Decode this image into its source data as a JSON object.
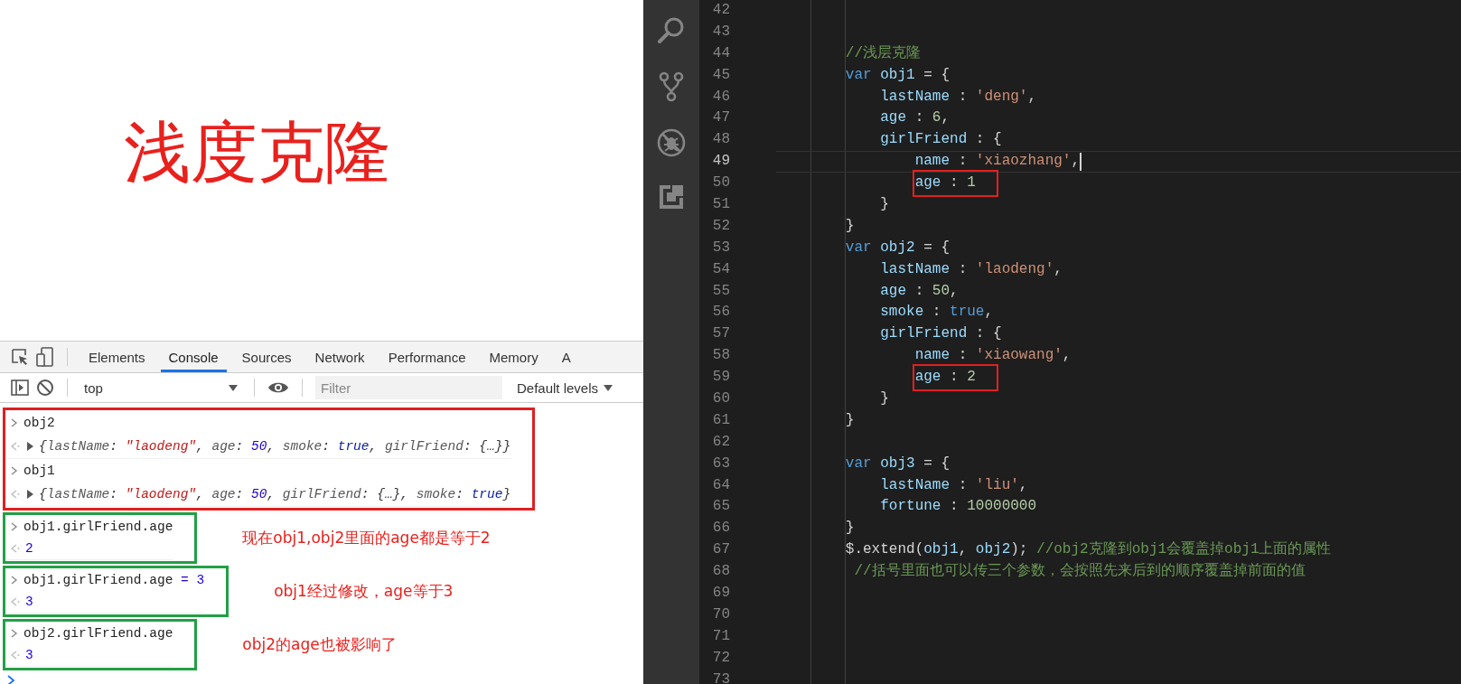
{
  "title": "浅度克隆",
  "devtools": {
    "tabs": [
      {
        "label": "Elements",
        "selected": false
      },
      {
        "label": "Console",
        "selected": true
      },
      {
        "label": "Sources",
        "selected": false
      },
      {
        "label": "Network",
        "selected": false
      },
      {
        "label": "Performance",
        "selected": false
      },
      {
        "label": "Memory",
        "selected": false
      },
      {
        "label": "A",
        "selected": false
      }
    ],
    "context": "top",
    "filter_placeholder": "Filter",
    "levels": "Default levels"
  },
  "console": {
    "groups": [
      {
        "color": "#e02020",
        "entries": [
          {
            "kind": "input",
            "expandable": false,
            "tokens": [
              {
                "text": "obj2",
                "kind": "plain"
              }
            ]
          },
          {
            "kind": "output",
            "expandable": true,
            "tokens": [
              {
                "text": "{",
                "kind": "p"
              },
              {
                "text": "lastName",
                "kind": "key"
              },
              {
                "text": ": ",
                "kind": "p"
              },
              {
                "text": "\"laodeng\"",
                "kind": "str"
              },
              {
                "text": ", ",
                "kind": "p"
              },
              {
                "text": "age",
                "kind": "key"
              },
              {
                "text": ": ",
                "kind": "p"
              },
              {
                "text": "50",
                "kind": "num"
              },
              {
                "text": ", ",
                "kind": "p"
              },
              {
                "text": "smoke",
                "kind": "key"
              },
              {
                "text": ": ",
                "kind": "p"
              },
              {
                "text": "true",
                "kind": "bool"
              },
              {
                "text": ", ",
                "kind": "p"
              },
              {
                "text": "girlFriend",
                "kind": "key"
              },
              {
                "text": ": {…}}",
                "kind": "p"
              }
            ]
          },
          {
            "kind": "input",
            "expandable": false,
            "tokens": [
              {
                "text": "obj1",
                "kind": "plain"
              }
            ]
          },
          {
            "kind": "output",
            "expandable": true,
            "tokens": [
              {
                "text": "{",
                "kind": "p"
              },
              {
                "text": "lastName",
                "kind": "key"
              },
              {
                "text": ": ",
                "kind": "p"
              },
              {
                "text": "\"laodeng\"",
                "kind": "str"
              },
              {
                "text": ", ",
                "kind": "p"
              },
              {
                "text": "age",
                "kind": "key"
              },
              {
                "text": ": ",
                "kind": "p"
              },
              {
                "text": "50",
                "kind": "num"
              },
              {
                "text": ", ",
                "kind": "p"
              },
              {
                "text": "girlFriend",
                "kind": "key"
              },
              {
                "text": ": {…}, ",
                "kind": "p"
              },
              {
                "text": "smoke",
                "kind": "key"
              },
              {
                "text": ": ",
                "kind": "p"
              },
              {
                "text": "true",
                "kind": "bool"
              },
              {
                "text": "}",
                "kind": "p"
              }
            ]
          }
        ]
      },
      {
        "color": "#22a045",
        "note": "现在obj1,obj2里面的age都是等于2",
        "entries": [
          {
            "kind": "input",
            "expandable": false,
            "tokens": [
              {
                "text": "obj1.girlFriend.age",
                "kind": "plain"
              }
            ]
          },
          {
            "kind": "output",
            "expandable": false,
            "tokens": [
              {
                "text": "2",
                "kind": "num"
              }
            ]
          }
        ]
      },
      {
        "color": "#22a045",
        "note": "obj1经过修改，age等于3",
        "entries": [
          {
            "kind": "input",
            "expandable": false,
            "tokens": [
              {
                "text": "obj1.girlFriend.age",
                "kind": "plain"
              },
              {
                "text": " = 3",
                "kind": "num"
              }
            ]
          },
          {
            "kind": "output",
            "expandable": false,
            "tokens": [
              {
                "text": "3",
                "kind": "num"
              }
            ]
          }
        ]
      },
      {
        "color": "#22a045",
        "note": "obj2的age也被影响了",
        "entries": [
          {
            "kind": "input",
            "expandable": false,
            "tokens": [
              {
                "text": "obj2.girlFriend.age",
                "kind": "plain"
              }
            ]
          },
          {
            "kind": "output",
            "expandable": false,
            "tokens": [
              {
                "text": "3",
                "kind": "num"
              }
            ]
          }
        ]
      }
    ]
  },
  "editor": {
    "lines": [
      {
        "number": "42",
        "current": false,
        "boxed": false
      },
      {
        "number": "43",
        "current": false,
        "boxed": false
      },
      {
        "number": "44",
        "current": false,
        "boxed": false,
        "tokens": [
          {
            "text": "        //浅层克隆",
            "kind": "cmt"
          }
        ]
      },
      {
        "number": "45",
        "current": false,
        "boxed": false,
        "tokens": [
          {
            "text": "        var ",
            "kind": "kw"
          },
          {
            "text": "obj1",
            "kind": "var"
          },
          {
            "text": " = {",
            "kind": "txt"
          }
        ]
      },
      {
        "number": "46",
        "current": false,
        "boxed": false,
        "tokens": [
          {
            "text": "            lastName",
            "kind": "var"
          },
          {
            "text": " : ",
            "kind": "txt"
          },
          {
            "text": "'deng'",
            "kind": "str"
          },
          {
            "text": ",",
            "kind": "txt"
          }
        ]
      },
      {
        "number": "47",
        "current": false,
        "boxed": false,
        "tokens": [
          {
            "text": "            age",
            "kind": "var"
          },
          {
            "text": " : ",
            "kind": "txt"
          },
          {
            "text": "6",
            "kind": "num"
          },
          {
            "text": ",",
            "kind": "txt"
          }
        ]
      },
      {
        "number": "48",
        "current": false,
        "boxed": false,
        "tokens": [
          {
            "text": "            girlFriend",
            "kind": "var"
          },
          {
            "text": " : {",
            "kind": "txt"
          }
        ]
      },
      {
        "number": "49",
        "current": true,
        "boxed": false,
        "tokens": [
          {
            "text": "                name",
            "kind": "var"
          },
          {
            "text": " : ",
            "kind": "txt"
          },
          {
            "text": "'xiaozhang'",
            "kind": "str"
          },
          {
            "text": ",",
            "kind": "txt"
          }
        ]
      },
      {
        "number": "50",
        "current": false,
        "boxed": true,
        "tokens": [
          {
            "text": "                age",
            "kind": "var"
          },
          {
            "text": " : ",
            "kind": "txt"
          },
          {
            "text": "1",
            "kind": "num"
          }
        ]
      },
      {
        "number": "51",
        "current": false,
        "boxed": false,
        "tokens": [
          {
            "text": "            }",
            "kind": "txt"
          }
        ]
      },
      {
        "number": "52",
        "current": false,
        "boxed": false,
        "tokens": [
          {
            "text": "        }",
            "kind": "txt"
          }
        ]
      },
      {
        "number": "53",
        "current": false,
        "boxed": false,
        "tokens": [
          {
            "text": "        var ",
            "kind": "kw"
          },
          {
            "text": "obj2",
            "kind": "var"
          },
          {
            "text": " = {",
            "kind": "txt"
          }
        ]
      },
      {
        "number": "54",
        "current": false,
        "boxed": false,
        "tokens": [
          {
            "text": "            lastName",
            "kind": "var"
          },
          {
            "text": " : ",
            "kind": "txt"
          },
          {
            "text": "'laodeng'",
            "kind": "str"
          },
          {
            "text": ",",
            "kind": "txt"
          }
        ]
      },
      {
        "number": "55",
        "current": false,
        "boxed": false,
        "tokens": [
          {
            "text": "            age",
            "kind": "var"
          },
          {
            "text": " : ",
            "kind": "txt"
          },
          {
            "text": "50",
            "kind": "num"
          },
          {
            "text": ",",
            "kind": "txt"
          }
        ]
      },
      {
        "number": "56",
        "current": false,
        "boxed": false,
        "tokens": [
          {
            "text": "            smoke",
            "kind": "var"
          },
          {
            "text": " : ",
            "kind": "txt"
          },
          {
            "text": "true",
            "kind": "kw"
          },
          {
            "text": ",",
            "kind": "txt"
          }
        ]
      },
      {
        "number": "57",
        "current": false,
        "boxed": false,
        "tokens": [
          {
            "text": "            girlFriend",
            "kind": "var"
          },
          {
            "text": " : {",
            "kind": "txt"
          }
        ]
      },
      {
        "number": "58",
        "current": false,
        "boxed": false,
        "tokens": [
          {
            "text": "                name",
            "kind": "var"
          },
          {
            "text": " : ",
            "kind": "txt"
          },
          {
            "text": "'xiaowang'",
            "kind": "str"
          },
          {
            "text": ",",
            "kind": "txt"
          }
        ]
      },
      {
        "number": "59",
        "current": false,
        "boxed": true,
        "tokens": [
          {
            "text": "                age",
            "kind": "var"
          },
          {
            "text": " : ",
            "kind": "txt"
          },
          {
            "text": "2",
            "kind": "num"
          }
        ]
      },
      {
        "number": "60",
        "current": false,
        "boxed": false,
        "tokens": [
          {
            "text": "            }",
            "kind": "txt"
          }
        ]
      },
      {
        "number": "61",
        "current": false,
        "boxed": false,
        "tokens": [
          {
            "text": "        }",
            "kind": "txt"
          }
        ]
      },
      {
        "number": "62",
        "current": false,
        "boxed": false
      },
      {
        "number": "63",
        "current": false,
        "boxed": false,
        "tokens": [
          {
            "text": "        var ",
            "kind": "kw"
          },
          {
            "text": "obj3",
            "kind": "var"
          },
          {
            "text": " = {",
            "kind": "txt"
          }
        ]
      },
      {
        "number": "64",
        "current": false,
        "boxed": false,
        "tokens": [
          {
            "text": "            lastName",
            "kind": "var"
          },
          {
            "text": " : ",
            "kind": "txt"
          },
          {
            "text": "'liu'",
            "kind": "str"
          },
          {
            "text": ",",
            "kind": "txt"
          }
        ]
      },
      {
        "number": "65",
        "current": false,
        "boxed": false,
        "tokens": [
          {
            "text": "            fortune",
            "kind": "var"
          },
          {
            "text": " : ",
            "kind": "txt"
          },
          {
            "text": "10000000",
            "kind": "num"
          }
        ]
      },
      {
        "number": "66",
        "current": false,
        "boxed": false,
        "tokens": [
          {
            "text": "        }",
            "kind": "txt"
          }
        ]
      },
      {
        "number": "67",
        "current": false,
        "boxed": false,
        "tokens": [
          {
            "text": "        $.extend(",
            "kind": "txt"
          },
          {
            "text": "obj1",
            "kind": "var"
          },
          {
            "text": ", ",
            "kind": "txt"
          },
          {
            "text": "obj2",
            "kind": "var"
          },
          {
            "text": "); ",
            "kind": "txt"
          },
          {
            "text": "//obj2克隆到obj1会覆盖掉obj1上面的属性",
            "kind": "cmt"
          }
        ]
      },
      {
        "number": "68",
        "current": false,
        "boxed": false,
        "tokens": [
          {
            "text": "         //括号里面也可以传三个参数，会按照先来后到的顺序覆盖掉前面的值",
            "kind": "cmt"
          }
        ]
      },
      {
        "number": "69",
        "current": false,
        "boxed": false
      },
      {
        "number": "70",
        "current": false,
        "boxed": false
      },
      {
        "number": "71",
        "current": false,
        "boxed": false
      },
      {
        "number": "72",
        "current": false,
        "boxed": false
      },
      {
        "number": "73",
        "current": false,
        "boxed": false
      }
    ]
  }
}
